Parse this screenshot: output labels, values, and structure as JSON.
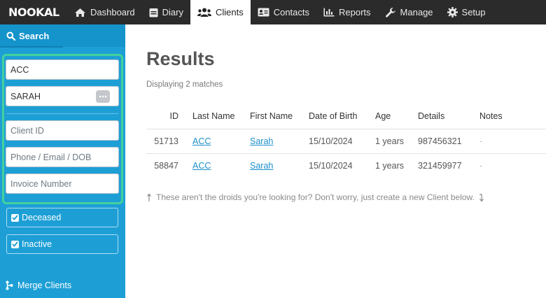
{
  "nav": {
    "logo": "NOOKAL",
    "items": [
      {
        "label": "Dashboard",
        "icon": "home-icon"
      },
      {
        "label": "Diary",
        "icon": "calendar-icon"
      },
      {
        "label": "Clients",
        "icon": "users-icon",
        "active": true
      },
      {
        "label": "Contacts",
        "icon": "address-card-icon"
      },
      {
        "label": "Reports",
        "icon": "bar-chart-icon"
      },
      {
        "label": "Manage",
        "icon": "wrench-icon"
      },
      {
        "label": "Setup",
        "icon": "gear-icon"
      }
    ]
  },
  "sidebar": {
    "heading": "Search",
    "fields": {
      "last_name_value": "ACC",
      "first_name_value": "SARAH",
      "client_id_placeholder": "Client ID",
      "contact_placeholder": "Phone / Email / DOB",
      "invoice_placeholder": "Invoice Number"
    },
    "checkboxes": {
      "deceased": "Deceased",
      "inactive": "Inactive"
    },
    "merge_label": "Merge Clients"
  },
  "results": {
    "title": "Results",
    "subtitle": "Displaying 2 matches",
    "columns": [
      "ID",
      "Last Name",
      "First Name",
      "Date of Birth",
      "Age",
      "Details",
      "Notes"
    ],
    "rows": [
      [
        "51713",
        "ACC",
        "Sarah",
        "15/10/2024",
        "1 years",
        "987456321",
        "-"
      ],
      [
        "58847",
        "ACC",
        "Sarah",
        "15/10/2024",
        "1 years",
        "321459977",
        "-"
      ]
    ],
    "hint": "These aren't the droids you're looking for? Don't worry, just create a new Client below."
  },
  "colors": {
    "sidebar": "#1d9fd6",
    "nav_bar": "#2b2b2b",
    "highlight": "#43d19d",
    "link": "#1d8fc9"
  }
}
